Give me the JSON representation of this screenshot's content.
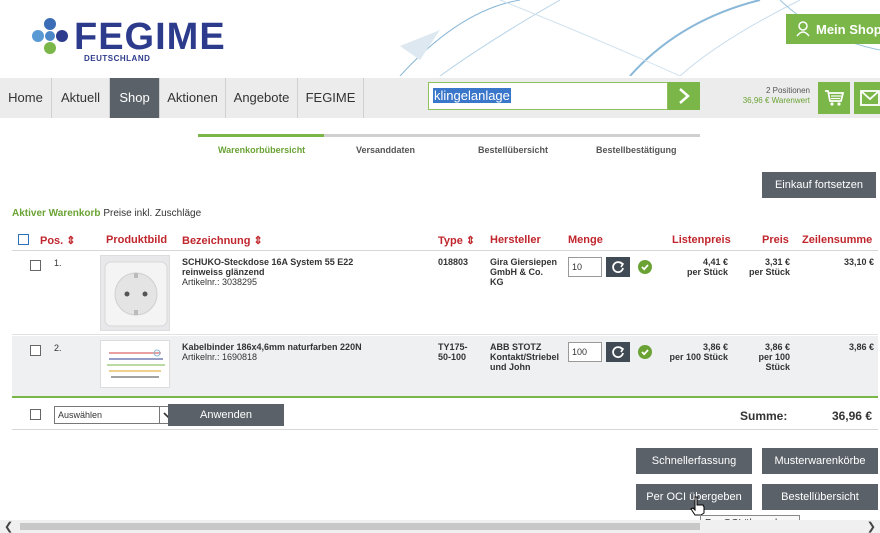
{
  "header": {
    "logo_text": "FEGIME",
    "logo_sub": "DEUTSCHLAND",
    "mein_shop": "Mein Shop"
  },
  "nav": {
    "items": [
      "Home",
      "Aktuell",
      "Shop",
      "Aktionen",
      "Angebote",
      "FEGIME"
    ],
    "active": "Shop",
    "search_value": "klingelanlage",
    "cart_positions": "2 Positionen",
    "cart_value": "36,96 € Warenwert"
  },
  "steps": [
    "Warenkorbübersicht",
    "Versanddaten",
    "Bestellübersicht",
    "Bestellbestätigung"
  ],
  "buttons": {
    "einkauf": "Einkauf fortsetzen",
    "anwenden": "Anwenden",
    "schnellerfassung": "Schnellerfassung",
    "musterwarenkoerbe": "Musterwarenkörbe",
    "oci": "Per OCI übergeben",
    "bestelluebersicht": "Bestellübersicht"
  },
  "cart": {
    "title_green": "Aktiver Warenkorb",
    "title_rest": " Preise inkl. Zuschläge"
  },
  "table": {
    "headers": {
      "pos": "Pos. ⇕",
      "bild": "Produktbild",
      "bez": "Bezeichnung ⇕",
      "type": "Type ⇕",
      "hersteller": "Hersteller",
      "menge": "Menge",
      "listenpreis": "Listenpreis",
      "preis": "Preis",
      "zeilensumme": "Zeilensumme"
    },
    "rows": [
      {
        "pos": "1.",
        "bez": "SCHUKO-Steckdose 16A System 55 E22",
        "bez2": "reinweiss glänzend",
        "artikel": "Artikelnr.: 3038295",
        "type": "018803",
        "hersteller": [
          "Gira Giersiepen",
          "GmbH & Co.",
          "KG"
        ],
        "menge": "10",
        "listenpreis": "4,41 €",
        "listenpreis_unit": "per Stück",
        "preis": "3,31 €",
        "preis_unit": [
          "per Stück"
        ],
        "summe": "33,10 €"
      },
      {
        "pos": "2.",
        "bez": "Kabelbinder 186x4,6mm naturfarben 220N",
        "bez2": "",
        "artikel": "Artikelnr.: 1690818",
        "type": "TY175-\n50-100",
        "type_lines": [
          "TY175-",
          "50-100"
        ],
        "hersteller": [
          "ABB STOTZ",
          "Kontakt/Striebel",
          "und John"
        ],
        "menge": "100",
        "listenpreis": "3,86 €",
        "listenpreis_unit": "per 100 Stück",
        "preis": "3,86 €",
        "preis_unit": [
          "per 100",
          "Stück"
        ],
        "summe": "3,86 €"
      }
    ]
  },
  "footer": {
    "select_value": "Auswählen",
    "summe_label": "Summe:",
    "summe_value": "36,96 €"
  },
  "tooltip": "Per OCI übergeben",
  "colors": {
    "green": "#7ab648",
    "red": "#c0262d",
    "dark_button": "#5a6168",
    "navy": "#2d3b8c"
  }
}
